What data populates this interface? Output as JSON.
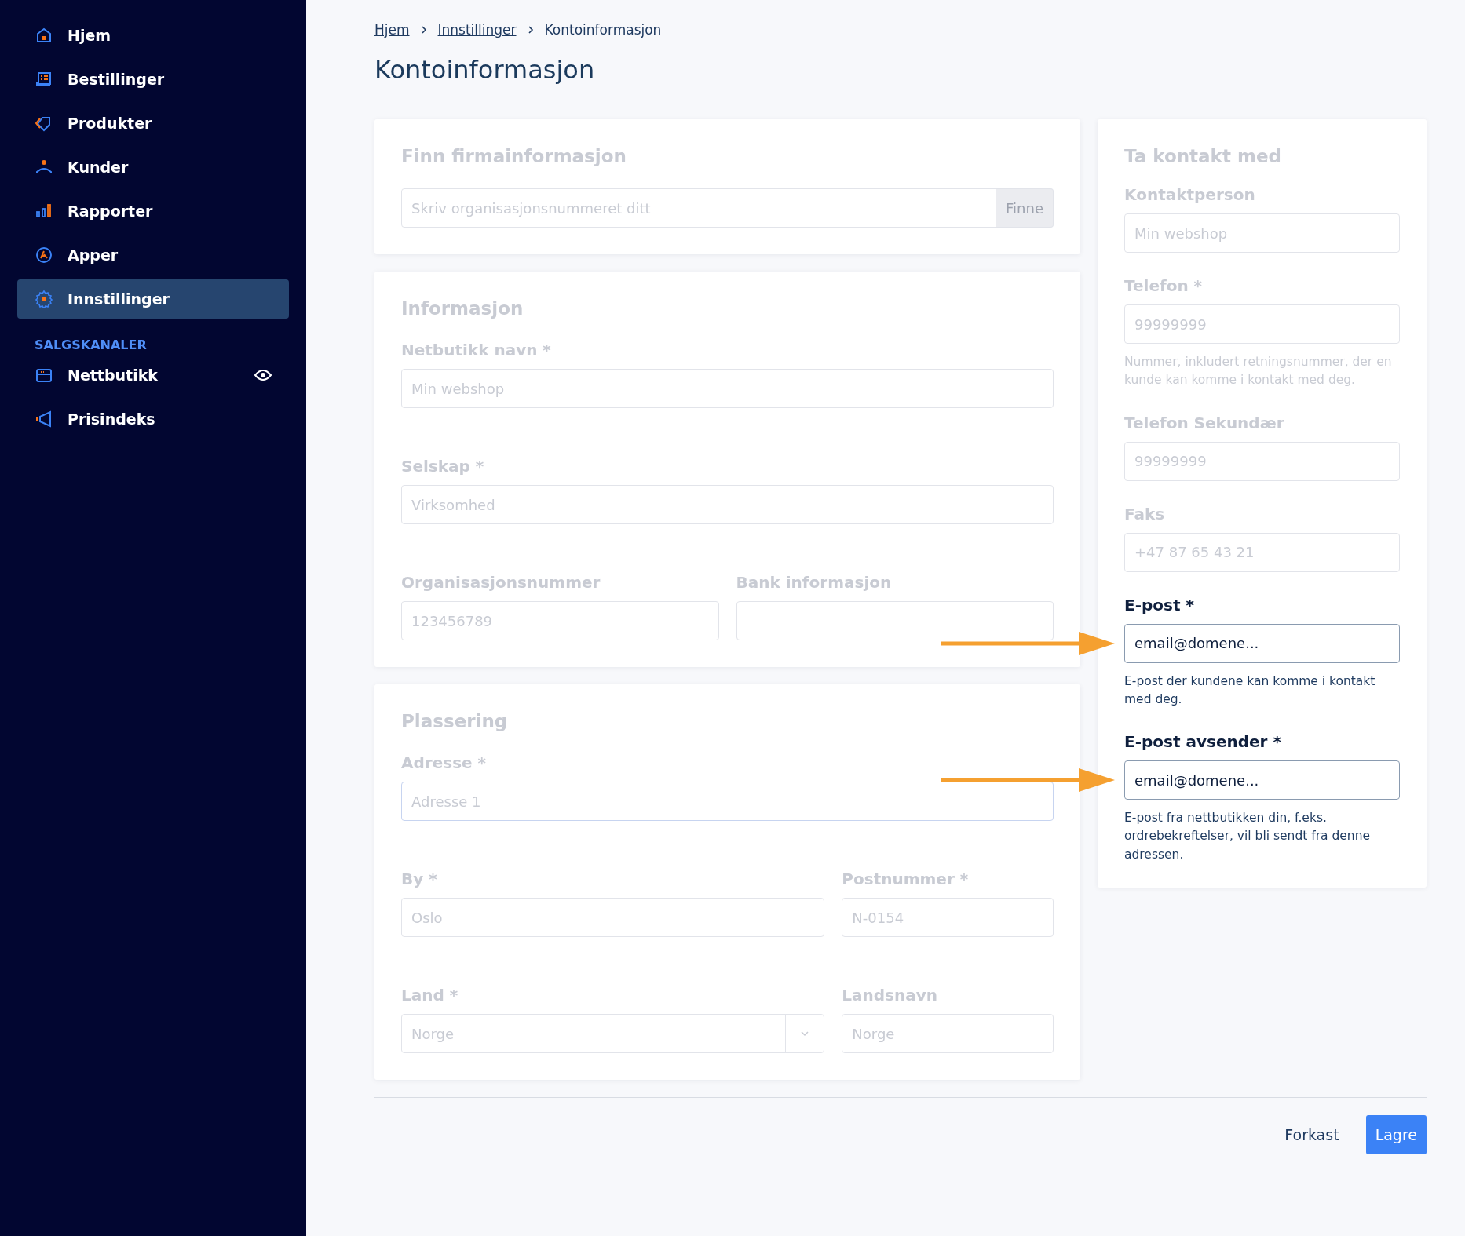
{
  "sidebar": {
    "items": [
      {
        "label": "Hjem",
        "selected": false
      },
      {
        "label": "Bestillinger",
        "selected": false
      },
      {
        "label": "Produkter",
        "selected": false
      },
      {
        "label": "Kunder",
        "selected": false
      },
      {
        "label": "Rapporter",
        "selected": false
      },
      {
        "label": "Apper",
        "selected": false
      },
      {
        "label": "Innstillinger",
        "selected": true
      }
    ],
    "section_title": "SALGSKANALER",
    "channels": [
      {
        "label": "Nettbutikk",
        "preview": true
      },
      {
        "label": "Prisindeks",
        "preview": false
      }
    ]
  },
  "breadcrumb": [
    {
      "label": "Hjem",
      "link": true
    },
    {
      "label": "Innstillinger",
      "link": true
    },
    {
      "label": "Kontoinformasjon",
      "link": false
    }
  ],
  "title": "Kontoinformasjon",
  "main_column": [
    {
      "title": "Finn firmainformasjon",
      "rows": [
        [
          {
            "kind": "search",
            "placeholder": "Skriv organisasjonsnummeret ditt",
            "button": "Finne",
            "highlighted": false,
            "focused": false
          }
        ]
      ]
    },
    {
      "title": "Informasjon",
      "rows": [
        [
          {
            "kind": "text",
            "label": "Netbutikk navn *",
            "placeholder": "Min webshop",
            "highlighted": false,
            "focused": false
          }
        ],
        [
          {
            "kind": "text",
            "label": "Selskap *",
            "placeholder": "Virksomhed",
            "highlighted": false,
            "focused": false
          }
        ],
        [
          {
            "kind": "text",
            "label": "Organisasjonsnummer",
            "placeholder": "123456789",
            "highlighted": false,
            "focused": false
          },
          {
            "kind": "text",
            "label": "Bank informasjon",
            "highlighted": false,
            "focused": false
          }
        ]
      ]
    },
    {
      "title": "Plassering",
      "rows": [
        [
          {
            "kind": "text",
            "label": "Adresse *",
            "placeholder": "Adresse 1",
            "highlighted": false,
            "focused": true
          }
        ],
        [
          {
            "kind": "text",
            "label": "By *",
            "placeholder": "Oslo",
            "highlighted": false,
            "focused": false
          },
          {
            "kind": "text",
            "label": "Postnummer *",
            "placeholder": "N-0154",
            "highlighted": false,
            "focused": false
          }
        ],
        [
          {
            "kind": "select",
            "label": "Land *",
            "placeholder": "Norge",
            "highlighted": false,
            "focused": false
          },
          {
            "kind": "text",
            "label": "Landsnavn",
            "placeholder": "Norge",
            "highlighted": false,
            "focused": false
          }
        ]
      ]
    }
  ],
  "side_column": [
    {
      "title": "Ta kontakt med",
      "rows": [
        [
          {
            "kind": "text",
            "label": "Kontaktperson",
            "placeholder": "Min webshop",
            "highlighted": false,
            "focused": false
          }
        ],
        [
          {
            "kind": "text",
            "label": "Telefon *",
            "placeholder": "99999999",
            "hint": "Nummer, inkludert retningsnummer, der en kunde kan komme i kontakt med deg.",
            "highlighted": false,
            "focused": false
          }
        ],
        [
          {
            "kind": "text",
            "label": "Telefon Sekundær",
            "placeholder": "99999999",
            "highlighted": false,
            "focused": false
          }
        ],
        [
          {
            "kind": "text",
            "label": "Faks",
            "placeholder": "+47 87 65 43 21",
            "highlighted": false,
            "focused": false
          }
        ],
        [
          {
            "kind": "text",
            "label": "E-post *",
            "value": "email@domene...",
            "hint": "E-post der kundene kan komme i kontakt med deg.",
            "highlighted": true,
            "focused": false
          }
        ],
        [
          {
            "kind": "text",
            "label": "E-post avsender *",
            "value": "email@domene...",
            "hint": "E-post fra nettbutikken din, f.eks. ordrebekreftelser, vil bli sendt fra denne adressen.",
            "highlighted": true,
            "focused": false
          }
        ]
      ]
    }
  ],
  "footer": {
    "buttons": [
      {
        "label": "Forkast",
        "kind": "secondary"
      },
      {
        "label": "Lagre",
        "kind": "primary"
      }
    ]
  }
}
